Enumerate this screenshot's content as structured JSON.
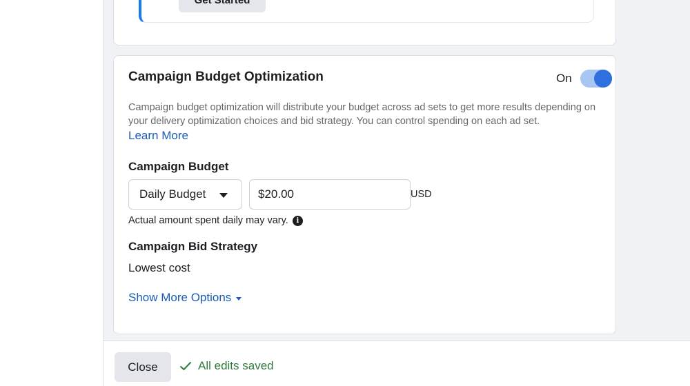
{
  "previous_card": {
    "button_label": "Get Started"
  },
  "cbo": {
    "title": "Campaign Budget Optimization",
    "toggle_label": "On",
    "toggle_state": "on",
    "description": "Campaign budget optimization will distribute your budget across ad sets to get more results depending on your delivery optimization choices and bid strategy. You can control spending on each ad set.",
    "learn_more": "Learn More",
    "budget": {
      "label": "Campaign Budget",
      "type_selected": "Daily Budget",
      "amount": "$20.00",
      "currency": "USD",
      "note": "Actual amount spent daily may vary."
    },
    "bid_strategy": {
      "label": "Campaign Bid Strategy",
      "value": "Lowest cost"
    },
    "show_more": "Show More Options"
  },
  "footer": {
    "close_label": "Close",
    "status": "All edits saved"
  },
  "colors": {
    "accent": "#1877f2",
    "link": "#1a5bb5",
    "toggle_track": "#a7c6f3",
    "toggle_knob": "#2f6fde",
    "success": "#2d7a3a",
    "page_background": "#f0f2f5"
  },
  "icons": {
    "dropdown": "caret-down-icon",
    "info": "info-icon",
    "show_more": "caret-down-icon",
    "status": "check-icon"
  }
}
